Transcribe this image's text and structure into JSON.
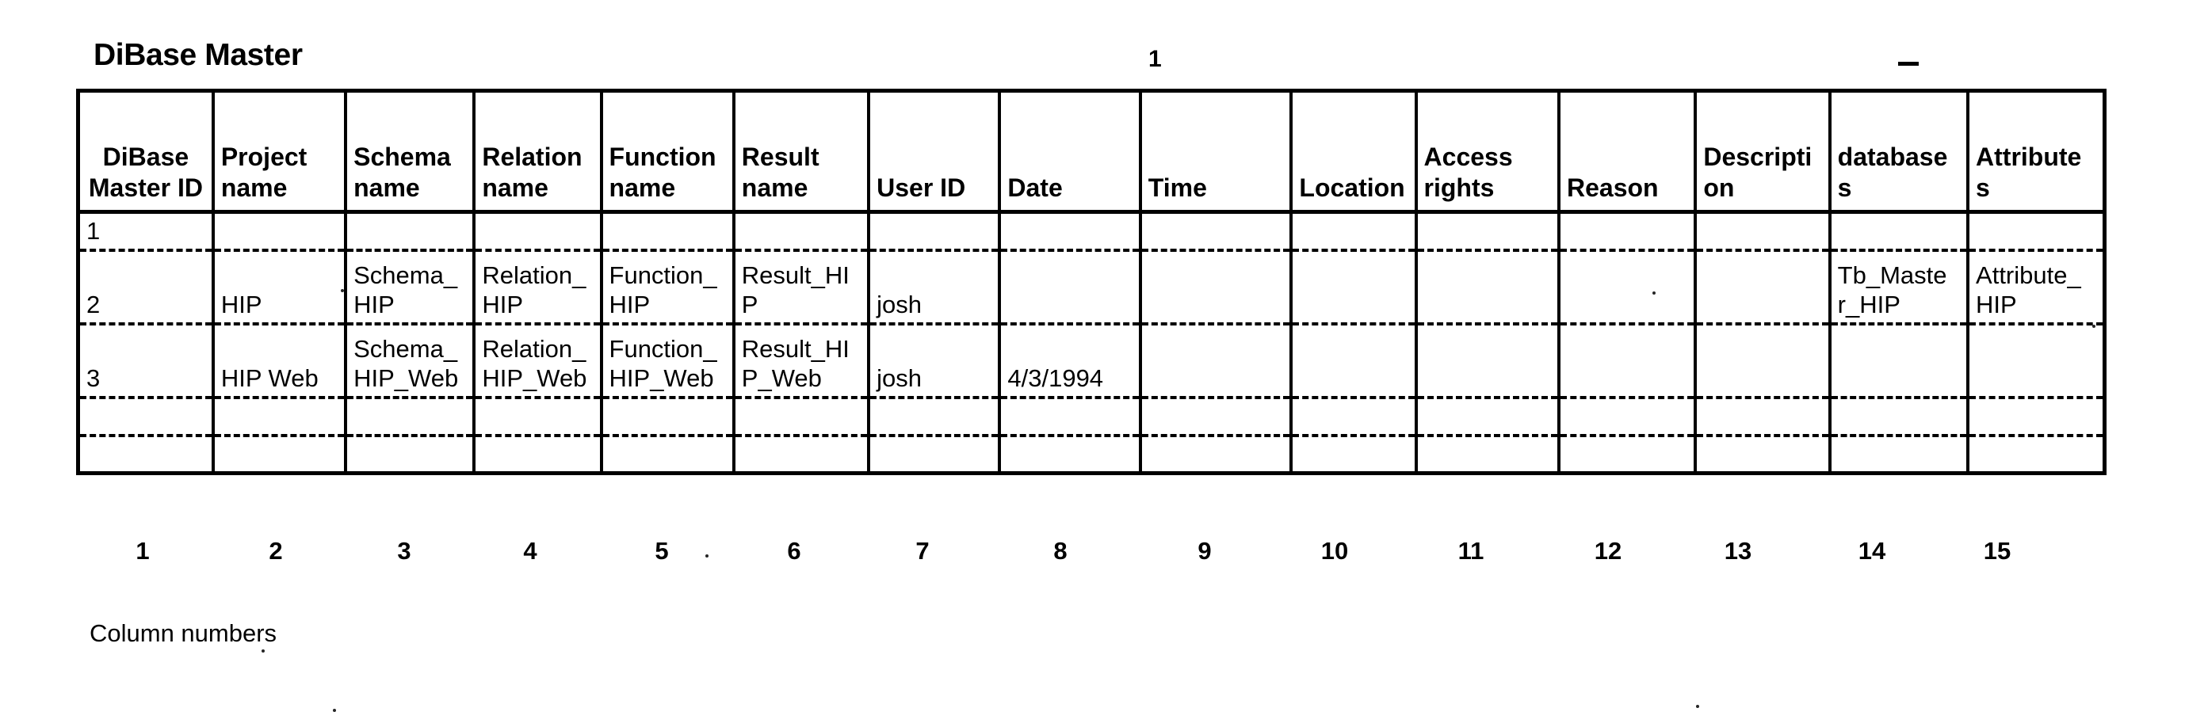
{
  "document": {
    "title": "DiBase Master",
    "page_number": "1",
    "caption": "Column numbers"
  },
  "table": {
    "headers": [
      "DiBase\nMaster ID",
      "Project\nname",
      "Schema\nname",
      "Relation\nname",
      "Function\nname",
      "Result\nname",
      "User ID",
      "Date",
      "Time",
      "Location",
      "Access\nrights",
      "Reason",
      "Descripti\non",
      "database\ns",
      "Attribute\ns"
    ],
    "headers_line1": [
      "DiBase",
      "Project",
      "Schema",
      "Relation",
      "Function",
      "Result",
      "User ID",
      "Date",
      "Time",
      "Location",
      "Access",
      "Reason",
      "Descripti",
      "database",
      "Attribute"
    ],
    "headers_line2": [
      "Master ID",
      "name",
      "name",
      "name",
      "name",
      "name",
      "",
      "",
      "",
      "",
      "rights",
      "",
      "on",
      "s",
      "s"
    ],
    "rows": [
      {
        "id": "1",
        "cells": [
          "",
          "",
          "",
          "",
          "",
          "",
          "",
          "",
          "",
          "",
          "",
          "",
          "",
          ""
        ]
      },
      {
        "id": "2",
        "cells": [
          "HIP",
          "Schema_\nHIP",
          "Relation_\nHIP",
          "Function_\nHIP",
          "Result_HI\nP",
          "josh",
          "",
          "",
          "",
          "",
          "",
          "",
          "Tb_Maste\nr_HIP",
          "Attribute_\nHIP"
        ]
      },
      {
        "id": "3",
        "cells": [
          "HIP Web",
          "Schema_\nHIP_Web",
          "Relation_\nHIP_Web",
          "Function_\nHIP_Web",
          "Result_HI\nP_Web",
          "josh",
          "4/3/1994",
          "",
          "",
          "",
          "",
          "",
          "",
          ""
        ]
      },
      {
        "id": "",
        "cells": [
          "",
          "",
          "",
          "",
          "",
          "",
          "",
          "",
          "",
          "",
          "",
          "",
          "",
          ""
        ]
      }
    ],
    "row2": {
      "c1": "2",
      "c2": "HIP",
      "c3a": "Schema_",
      "c3b": "HIP",
      "c4a": "Relation_",
      "c4b": "HIP",
      "c5a": "Function_",
      "c5b": "HIP",
      "c6a": "Result_HI",
      "c6b": "P",
      "c7": "josh",
      "c8": "",
      "c9": "",
      "c10": "",
      "c11": "",
      "c12": "",
      "c13": "",
      "c14a": "Tb_Maste",
      "c14b": "r_HIP",
      "c15a": "Attribute_",
      "c15b": "HIP"
    },
    "row3": {
      "c1": "3",
      "c2": "HIP Web",
      "c3a": "Schema_",
      "c3b": "HIP_Web",
      "c4a": "Relation_",
      "c4b": "HIP_Web",
      "c5a": "Function_",
      "c5b": "HIP_Web",
      "c6a": "Result_HI",
      "c6b": "P_Web",
      "c7": "josh",
      "c8": "4/3/1994",
      "c9": "",
      "c10": "",
      "c11": "",
      "c12": "",
      "c13": "",
      "c14": "",
      "c15": ""
    },
    "row1": {
      "c1": "1"
    },
    "row4": {
      "c1": ""
    },
    "column_numbers": [
      "1",
      "2",
      "3",
      "4",
      "5",
      "6",
      "7",
      "8",
      "9",
      "10",
      "11",
      "12",
      "13",
      "14",
      "15"
    ]
  }
}
